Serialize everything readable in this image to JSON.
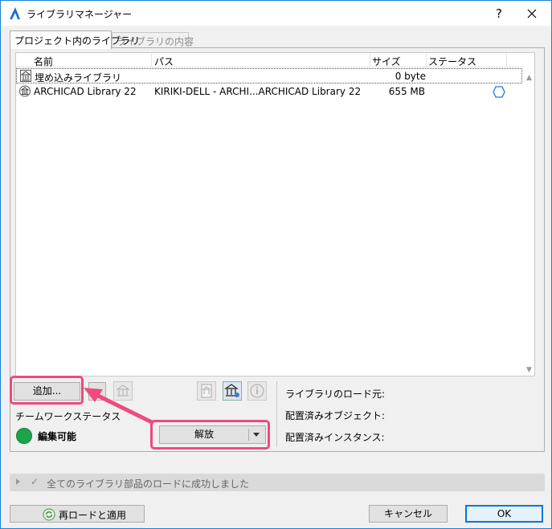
{
  "window": {
    "title": "ライブラリマネージャー",
    "help_glyph": "?"
  },
  "tabs": [
    {
      "label": "プロジェクト内のライブラリ",
      "active": true
    },
    {
      "label": "ライブラリの内容",
      "active": false
    }
  ],
  "library_list": {
    "columns": [
      "名前",
      "パス",
      "サイズ",
      "ステータス"
    ],
    "rows": [
      {
        "name": "埋め込みライブラリ",
        "path": "",
        "size": "0 byte",
        "status": "",
        "icon": "embedded-library-icon"
      },
      {
        "name": "ARCHICAD Library 22",
        "path": "KIRIKI-DELL - ARCHI...ARCHICAD Library 22",
        "size": "655 MB",
        "status": "",
        "icon": "library-icon",
        "status_icon": "hexagon-status-icon"
      }
    ]
  },
  "toolbar": {
    "add_label": "追加..."
  },
  "teamwork": {
    "label": "チームワークステータス",
    "status": "編集可能",
    "status_color": "#1ea34b",
    "release_label": "解放"
  },
  "info": {
    "load_from": "ライブラリのロード元:",
    "placed_objects": "配置済みオブジェクト:",
    "placed_instances": "配置済みインスタンス:"
  },
  "status_bar": {
    "message": "全てのライブラリ部品のロードに成功しました"
  },
  "footer": {
    "reload_label": "再ロードと適用",
    "cancel_label": "キャンセル",
    "ok_label": "OK"
  },
  "colors": {
    "highlight": "#ef4a7d",
    "accent": "#0078d7"
  }
}
